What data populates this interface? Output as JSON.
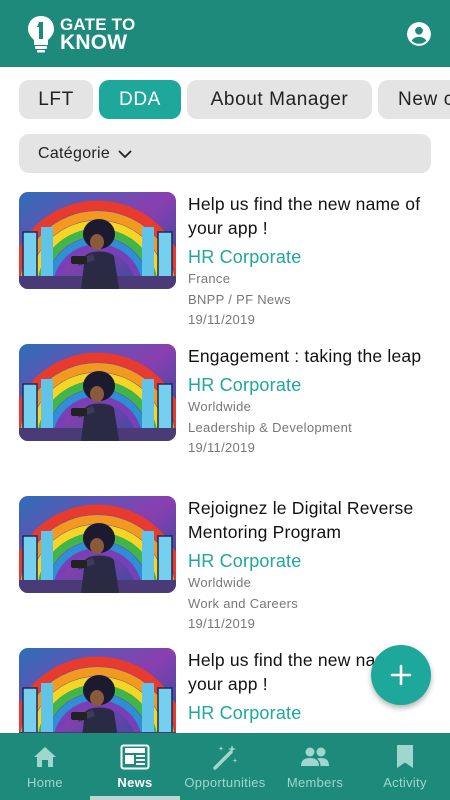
{
  "header": {
    "logo_line1": "GATE TO",
    "logo_line2": "KNOW",
    "account_icon": "account-circle-icon"
  },
  "tabs": [
    {
      "label": "LFT",
      "active": false
    },
    {
      "label": "DDA",
      "active": true
    },
    {
      "label": "About Manager",
      "active": false
    },
    {
      "label": "New c",
      "active": false
    }
  ],
  "filter": {
    "label": "Catégorie",
    "icon": "chevron-down-icon"
  },
  "articles": [
    {
      "title": "Help us find the new name of your app !",
      "author": "HR Corporate",
      "region": "France",
      "category": "BNPP / PF News",
      "date": "19/11/2019"
    },
    {
      "title": "Engagement : taking the leap",
      "author": "HR Corporate",
      "region": "Worldwide",
      "category": "Leadership & Development",
      "date": "19/11/2019"
    },
    {
      "title": "Rejoignez le Digital Reverse Mentoring Program",
      "author": "HR Corporate",
      "region": "Worldwide",
      "category": "Work and Careers",
      "date": "19/11/2019"
    },
    {
      "title": "Help us find the new name of your app !",
      "author": "HR Corporate",
      "region": "",
      "category": "",
      "date": ""
    }
  ],
  "fab": {
    "icon": "plus-icon"
  },
  "bottom_nav": [
    {
      "label": "Home",
      "icon": "home-icon",
      "active": false
    },
    {
      "label": "News",
      "icon": "news-icon",
      "active": true
    },
    {
      "label": "Opportunities",
      "icon": "magic-wand-icon",
      "active": false
    },
    {
      "label": "Members",
      "icon": "people-icon",
      "active": false
    },
    {
      "label": "Activity",
      "icon": "bookmark-icon",
      "active": false
    }
  ],
  "colors": {
    "primary": "#1e8a7c",
    "accent": "#1ea79b",
    "chip": "#e4e4e4"
  }
}
